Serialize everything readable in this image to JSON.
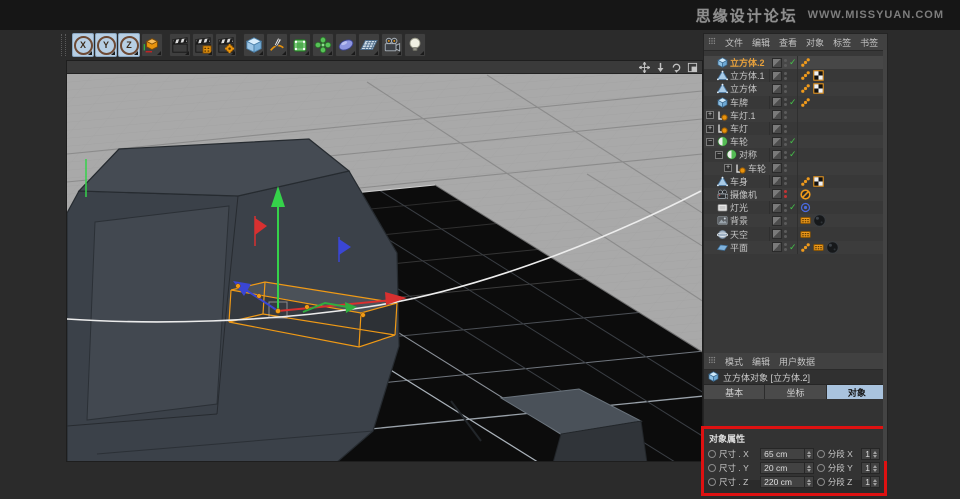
{
  "banner": {
    "site_name": "思缘设计论坛",
    "site_url": "WWW.MISSYUAN.COM"
  },
  "toolbar": {
    "groups": [
      {
        "buttons": [
          {
            "name": "lock-x-axis",
            "type": "axis",
            "label": "X",
            "active": true
          },
          {
            "name": "lock-y-axis",
            "type": "axis",
            "label": "Y",
            "active": true
          },
          {
            "name": "lock-z-axis",
            "type": "axis",
            "label": "Z",
            "active": true
          },
          {
            "name": "coordinate-system",
            "type": "coord-cube",
            "active": false
          }
        ]
      },
      {
        "buttons": [
          {
            "name": "render-view",
            "type": "clapper",
            "active": false
          },
          {
            "name": "render-picture-viewer",
            "type": "clapper-film",
            "active": false
          },
          {
            "name": "render-settings",
            "type": "clapper-gear",
            "active": false
          }
        ]
      },
      {
        "buttons": [
          {
            "name": "add-cube",
            "type": "cube-blue",
            "active": false
          },
          {
            "name": "spline-pen",
            "type": "pen",
            "active": false
          },
          {
            "name": "subdivision-surface",
            "type": "subdiv",
            "active": false
          },
          {
            "name": "deformer",
            "type": "deformer",
            "active": false
          },
          {
            "name": "environment",
            "type": "environment",
            "active": false
          },
          {
            "name": "floor",
            "type": "floor-grid",
            "active": false
          },
          {
            "name": "camera",
            "type": "camera",
            "active": false
          },
          {
            "name": "light",
            "type": "light-bulb",
            "active": false
          }
        ]
      }
    ]
  },
  "viewport": {
    "nav": [
      {
        "name": "pan-view",
        "type": "pan"
      },
      {
        "name": "dolly-view",
        "type": "dolly"
      },
      {
        "name": "rotate-view",
        "type": "rotate"
      },
      {
        "name": "toggle-view",
        "type": "toggle-view"
      }
    ]
  },
  "object_manager": {
    "menu": [
      "文件",
      "编辑",
      "查看",
      "对象",
      "标签",
      "书签"
    ],
    "objects": [
      {
        "name": "立方体.2",
        "icon": "cube",
        "indent": 0,
        "expander": null,
        "check": true,
        "dots": "gray",
        "tags": [
          "phong"
        ],
        "selected": true
      },
      {
        "name": "立方体.1",
        "icon": "polygon",
        "indent": 0,
        "expander": null,
        "check": false,
        "dots": "gray",
        "tags": [
          "phong",
          "texture"
        ],
        "selected": false
      },
      {
        "name": "立方体",
        "icon": "polygon",
        "indent": 0,
        "expander": null,
        "check": false,
        "dots": "gray",
        "tags": [
          "phong",
          "texture"
        ],
        "selected": false
      },
      {
        "name": "车牌",
        "icon": "cube",
        "indent": 0,
        "expander": null,
        "check": true,
        "dots": "gray",
        "tags": [
          "phong"
        ],
        "selected": false
      },
      {
        "name": "车灯.1",
        "icon": "lamp",
        "indent": 0,
        "expander": "plus",
        "check": false,
        "dots": "gray",
        "tags": [],
        "selected": false
      },
      {
        "name": "车灯",
        "icon": "lamp",
        "indent": 0,
        "expander": "plus",
        "check": false,
        "dots": "gray",
        "tags": [],
        "selected": false
      },
      {
        "name": "车轮",
        "icon": "symmetry",
        "indent": 0,
        "expander": "minus",
        "check": true,
        "dots": "gray",
        "tags": [],
        "selected": false
      },
      {
        "name": "对称",
        "icon": "symmetry",
        "indent": 1,
        "expander": "minus",
        "check": true,
        "dots": "gray",
        "tags": [],
        "selected": false
      },
      {
        "name": "车轮",
        "icon": "lamp",
        "indent": 2,
        "expander": "plus",
        "check": false,
        "dots": "gray",
        "tags": [],
        "selected": false
      },
      {
        "name": "车身",
        "icon": "polygon",
        "indent": 0,
        "expander": null,
        "check": false,
        "dots": "gray",
        "tags": [
          "phong",
          "texture"
        ],
        "selected": false
      },
      {
        "name": "摄像机",
        "icon": "camera-obj",
        "indent": 0,
        "expander": null,
        "check": false,
        "dots": "red",
        "tags": [
          "protection"
        ],
        "selected": false
      },
      {
        "name": "灯光",
        "icon": "light-flat",
        "indent": 0,
        "expander": null,
        "check": true,
        "dots": "gray",
        "tags": [
          "target"
        ],
        "selected": false
      },
      {
        "name": "背景",
        "icon": "background",
        "indent": 0,
        "expander": null,
        "check": false,
        "dots": "gray",
        "tags": [
          "compositing",
          "material"
        ],
        "selected": false
      },
      {
        "name": "天空",
        "icon": "sky",
        "indent": 0,
        "expander": null,
        "check": false,
        "dots": "gray",
        "tags": [
          "compositing"
        ],
        "selected": false
      },
      {
        "name": "平面",
        "icon": "plane",
        "indent": 0,
        "expander": null,
        "check": true,
        "dots": "gray",
        "tags": [
          "phong",
          "compositing",
          "material"
        ],
        "selected": false
      }
    ]
  },
  "attribute_manager": {
    "menu": [
      "模式",
      "编辑",
      "用户数据"
    ],
    "title": "立方体对象 [立方体.2]",
    "tabs": [
      {
        "label": "基本",
        "active": false
      },
      {
        "label": "坐标",
        "active": false
      },
      {
        "label": "对象",
        "active": true
      }
    ],
    "section_title": "对象属性",
    "rows": [
      {
        "dim_label": "尺寸 . X",
        "dim_value": "65 cm",
        "seg_label": "分段 X",
        "seg_value": "1"
      },
      {
        "dim_label": "尺寸 . Y",
        "dim_value": "20 cm",
        "seg_label": "分段 Y",
        "seg_value": "1"
      },
      {
        "dim_label": "尺寸 . Z",
        "dim_value": "220 cm",
        "seg_label": "分段 Z",
        "seg_value": "1"
      }
    ]
  },
  "colors": {
    "annotation_red": "#de1111",
    "selection_orange": "#e8930c",
    "active_tab_blue": "#a9c3de",
    "axis_x_red": "#d83030",
    "axis_y_green": "#35d24a",
    "axis_z_blue": "#3a46d4"
  }
}
